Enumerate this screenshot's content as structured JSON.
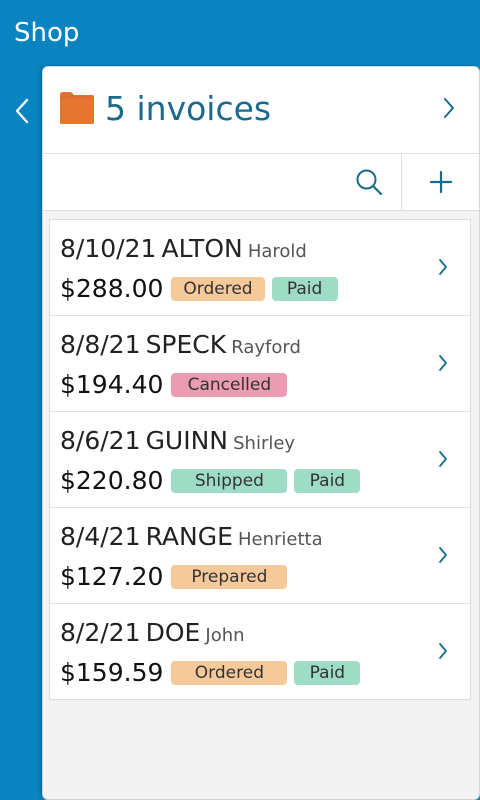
{
  "app": {
    "title": "Shop"
  },
  "header": {
    "title": "5 invoices"
  },
  "colors": {
    "accent": "#0a84c1",
    "title_text": "#1a6a8e",
    "folder": "#e07030",
    "ordered": "#f5c99a",
    "paid": "#9fdcc6",
    "cancelled": "#eb9bb2",
    "shipped": "#9fdcc6",
    "prepared": "#f5c99a"
  },
  "icons": {
    "back": "chevron-left-icon",
    "folder": "folder-icon",
    "search": "search-icon",
    "add": "plus-icon",
    "row_open": "chevron-right-icon"
  },
  "invoices": [
    {
      "date": "8/10/21",
      "last_name": "ALTON",
      "first_name": "Harold",
      "amount": "$288.00",
      "status": "Ordered",
      "status_color": "#f5c99a",
      "paid": "Paid"
    },
    {
      "date": "8/8/21",
      "last_name": "SPECK",
      "first_name": "Rayford",
      "amount": "$194.40",
      "status": "Cancelled",
      "status_color": "#eb9bb2",
      "paid": ""
    },
    {
      "date": "8/6/21",
      "last_name": "GUINN",
      "first_name": "Shirley",
      "amount": "$220.80",
      "status": "Shipped",
      "status_color": "#9fdcc6",
      "paid": "Paid"
    },
    {
      "date": "8/4/21",
      "last_name": "RANGE",
      "first_name": "Henrietta",
      "amount": "$127.20",
      "status": "Prepared",
      "status_color": "#f5c99a",
      "paid": ""
    },
    {
      "date": "8/2/21",
      "last_name": "DOE",
      "first_name": "John",
      "amount": "$159.59",
      "status": "Ordered",
      "status_color": "#f5c99a",
      "paid": "Paid"
    }
  ]
}
